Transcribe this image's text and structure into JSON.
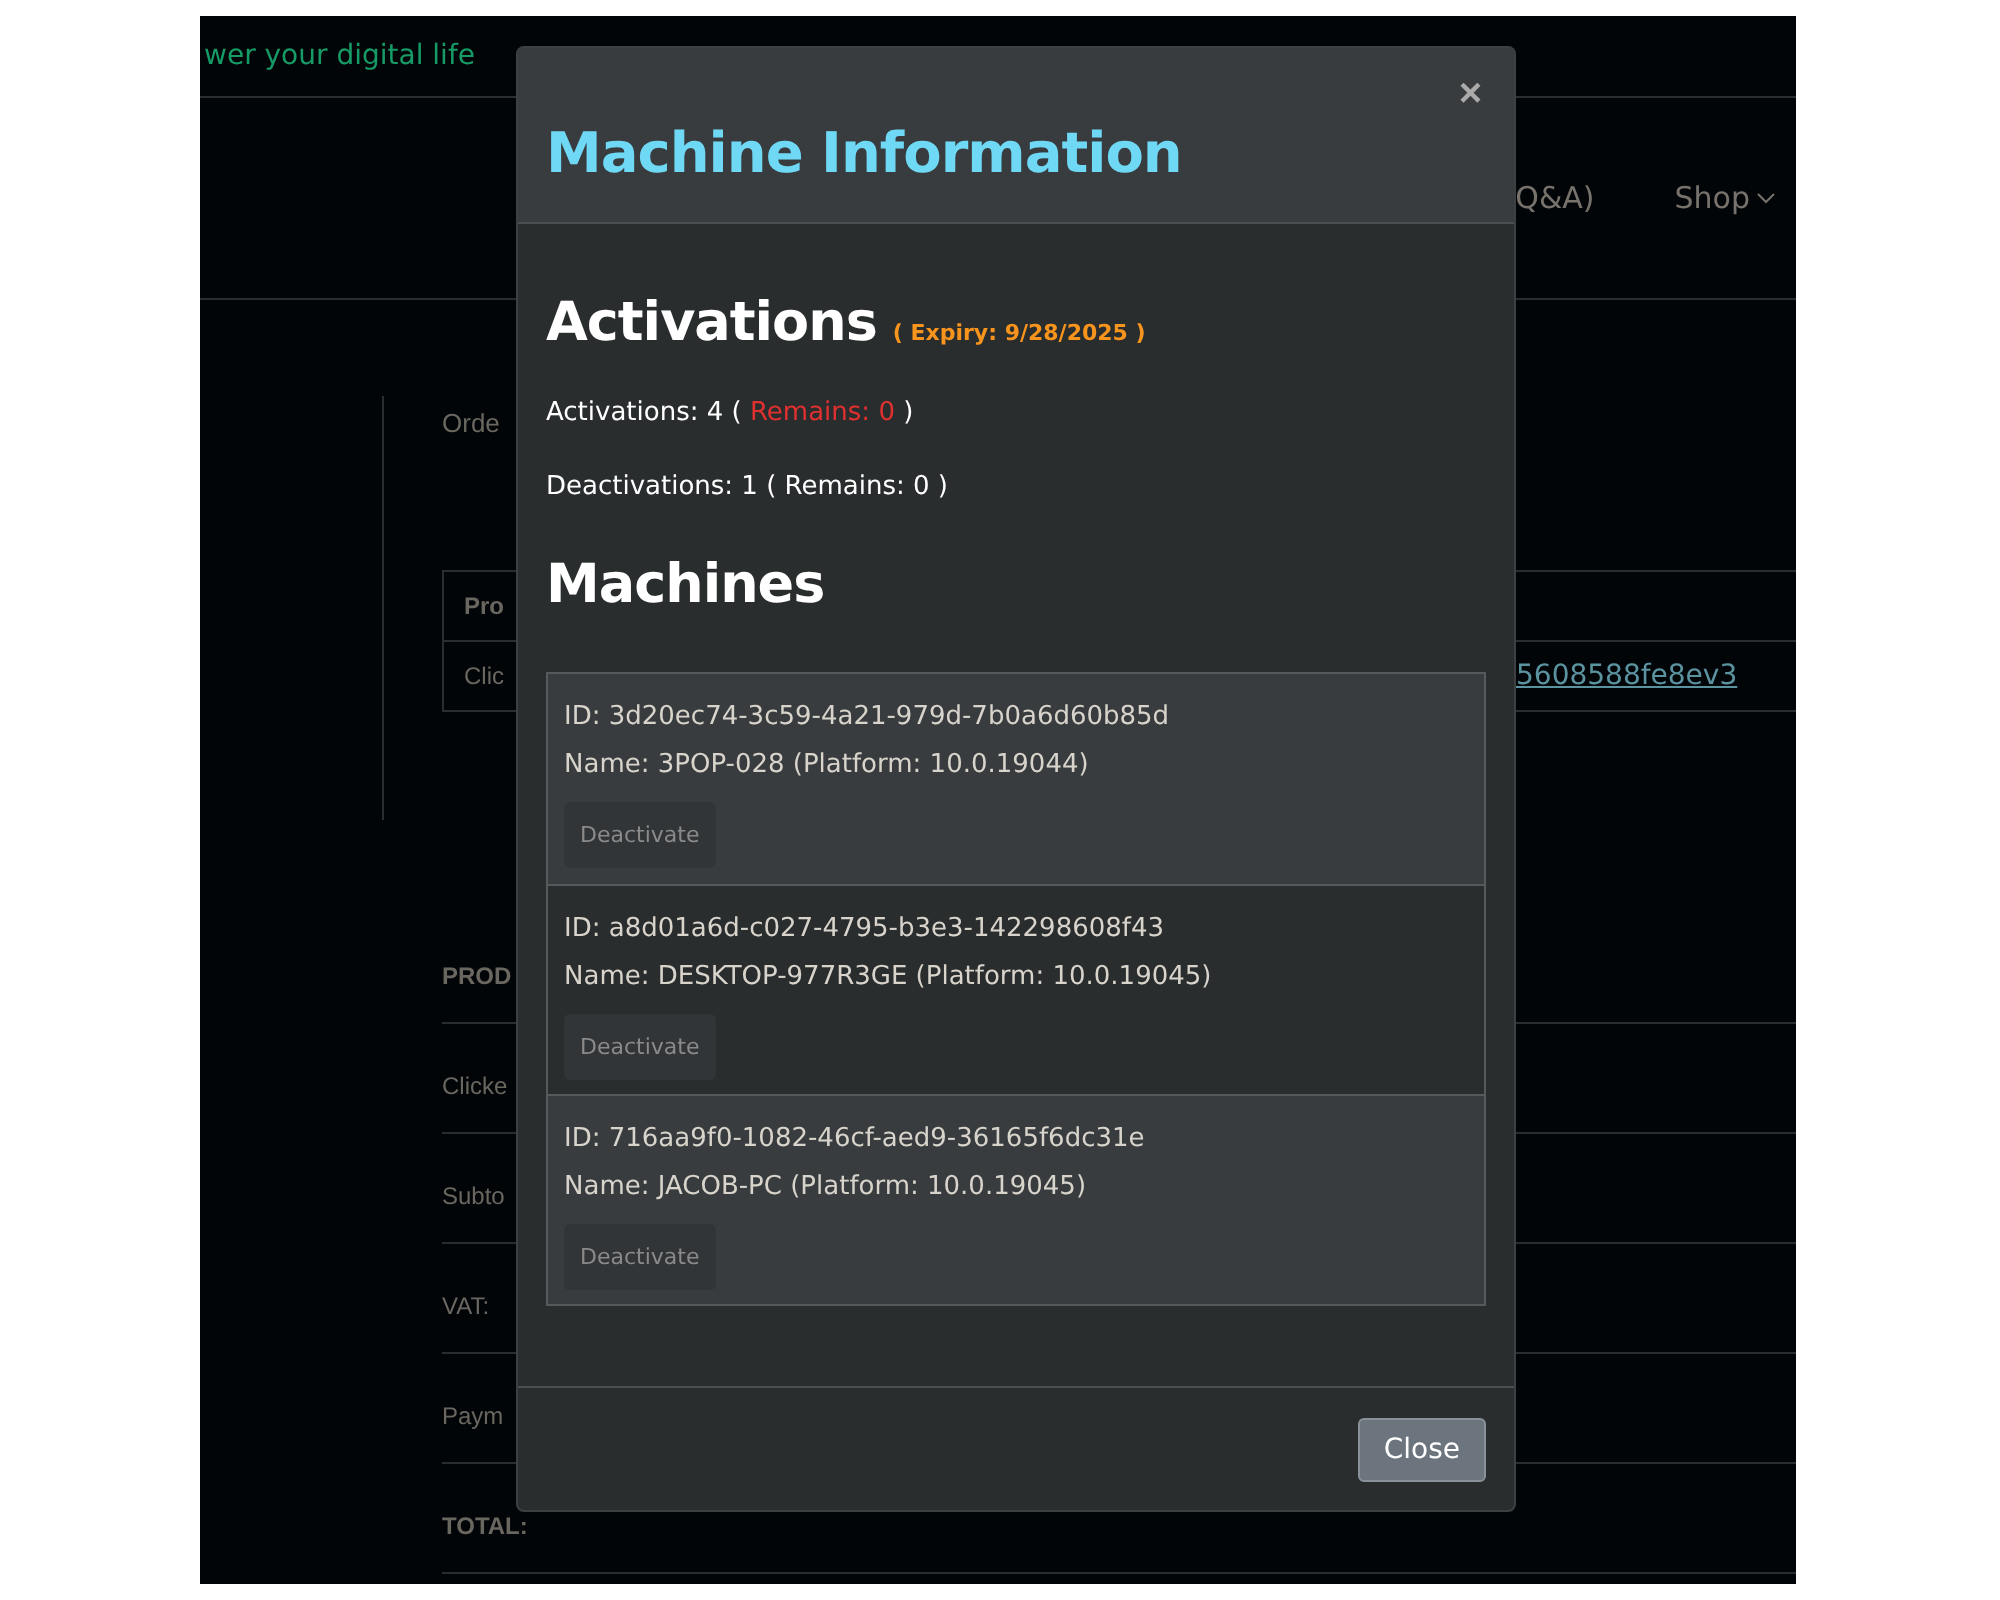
{
  "background": {
    "tagline": "wer your digital life",
    "nav": [
      {
        "label": "Q&A)",
        "kind": "link"
      },
      {
        "label": "Shop",
        "kind": "dropdown"
      }
    ],
    "order_label": "Orde",
    "table": {
      "header": "Pro",
      "cell": "Clic",
      "link": "5608588fe8ev3"
    },
    "summary": [
      {
        "label": "PROD",
        "bold": true
      },
      {
        "label": "Clicke",
        "bold": false
      },
      {
        "label": "Subto",
        "bold": false
      },
      {
        "label": "VAT:",
        "bold": false
      },
      {
        "label": "Paym",
        "bold": false
      },
      {
        "label": "TOTAL:",
        "bold": true
      }
    ]
  },
  "modal": {
    "title": "Machine Information",
    "close": "×",
    "activations_heading": "Activations",
    "expiry": "( Expiry: 9/28/2025 )",
    "counts": [
      {
        "parts": [
          {
            "text": "Activations: 4 ( ",
            "alert": false
          },
          {
            "text": "Remains: 0",
            "alert": true
          },
          {
            "text": " )",
            "alert": false
          }
        ]
      },
      {
        "parts": [
          {
            "text": "Deactivations: 1 ( Remains: 0 )",
            "alert": false
          }
        ]
      }
    ],
    "machines_heading": "Machines",
    "machines": [
      {
        "id": "ID: 3d20ec74-3c59-4a21-979d-7b0a6d60b85d",
        "name": "Name: 3POP-028 (Platform: 10.0.19044)",
        "button": "Deactivate"
      },
      {
        "id": "ID: a8d01a6d-c027-4795-b3e3-142298608f43",
        "name": "Name: DESKTOP-977R3GE (Platform: 10.0.19045)",
        "button": "Deactivate"
      },
      {
        "id": "ID: 716aa9f0-1082-46cf-aed9-36165f6dc31e",
        "name": "Name: JACOB-PC (Platform: 10.0.19045)",
        "button": "Deactivate"
      }
    ],
    "footer_button": "Close"
  }
}
